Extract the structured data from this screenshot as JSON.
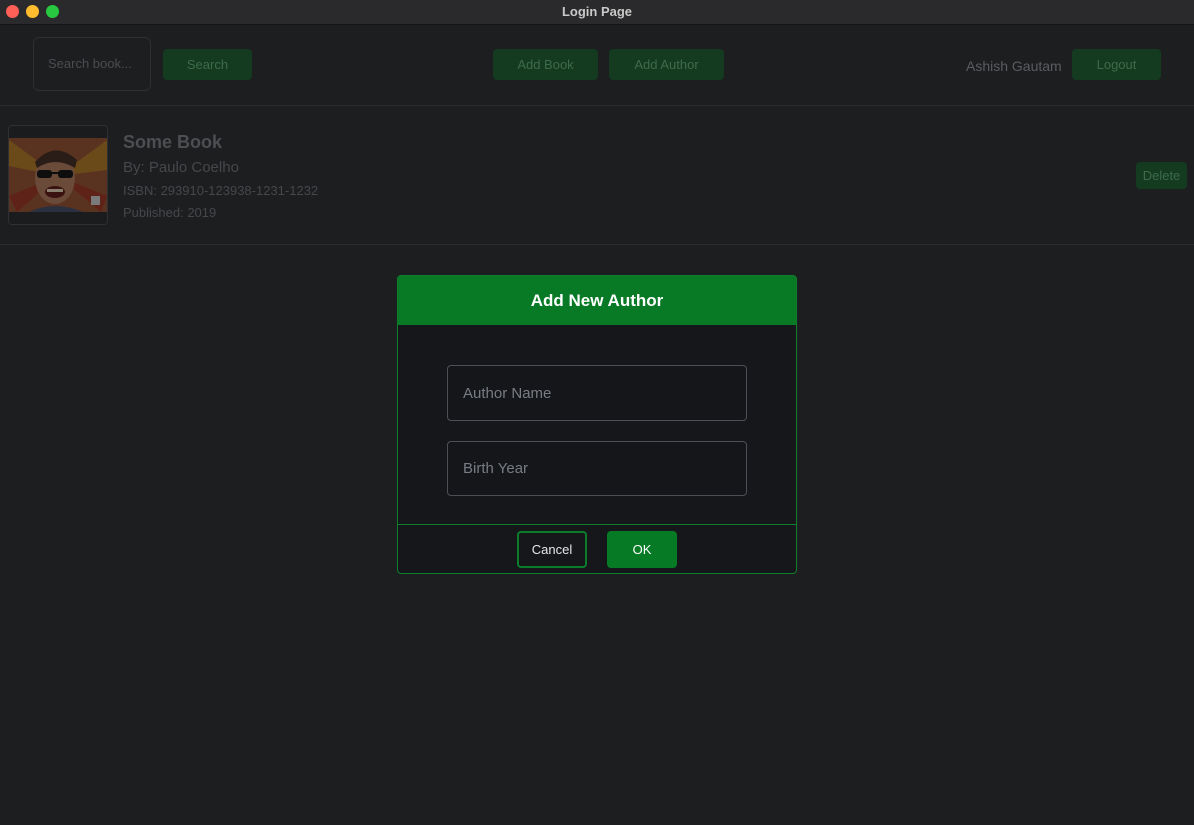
{
  "window": {
    "title": "Login Page"
  },
  "toolbar": {
    "search_placeholder": "Search book...",
    "search_label": "Search",
    "add_book_label": "Add Book",
    "add_author_label": "Add Author",
    "user_name": "Ashish Gautam",
    "logout_label": "Logout"
  },
  "book": {
    "title": "Some Book",
    "author": "By: Paulo Coelho",
    "isbn": "ISBN: 293910-123938-1231-1232",
    "published": "Published: 2019",
    "delete_label": "Delete"
  },
  "modal": {
    "title": "Add New Author",
    "author_name_placeholder": "Author Name",
    "birth_year_placeholder": "Birth Year",
    "cancel_label": "Cancel",
    "ok_label": "OK"
  },
  "colors": {
    "accent": "#087a26",
    "background": "#1d1e20",
    "modal_background": "#16171a"
  }
}
